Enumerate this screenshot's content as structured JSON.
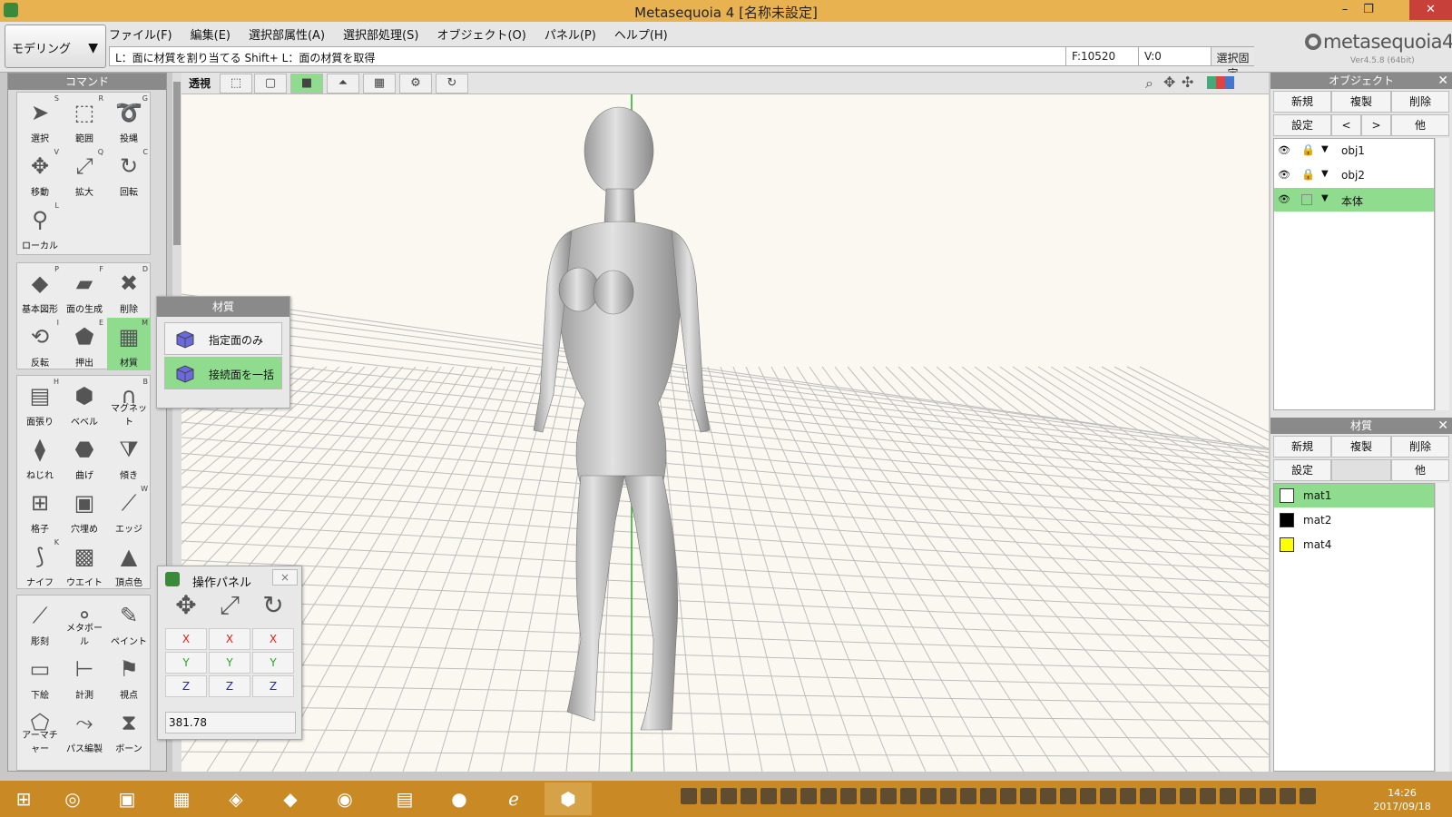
{
  "window": {
    "title": "Metasequoia 4 [名称未設定]"
  },
  "mode": {
    "label": "モデリング"
  },
  "menu": [
    "ファイル(F)",
    "編集(E)",
    "選択部属性(A)",
    "選択部処理(S)",
    "オブジェクト(O)",
    "パネル(P)",
    "ヘルプ(H)"
  ],
  "status": {
    "message": "L：面に材質を割り当てる  Shift+ L：面の材質を取得",
    "faces": "F:10520",
    "vertices": "V:0",
    "lock_label": "選択固定"
  },
  "logo": {
    "text": "metasequoia4",
    "version": "Ver4.5.8 (64bit)"
  },
  "command_panel": {
    "header": "コマンド",
    "group1": [
      {
        "label": "選択",
        "key": "S",
        "icon": "cursor-icon"
      },
      {
        "label": "範囲",
        "key": "R",
        "icon": "range-select-icon"
      },
      {
        "label": "投縄",
        "key": "G",
        "icon": "lasso-icon"
      },
      {
        "label": "移動",
        "key": "V",
        "icon": "move-icon"
      },
      {
        "label": "拡大",
        "key": "Q",
        "icon": "scale-icon"
      },
      {
        "label": "回転",
        "key": "C",
        "icon": "rotate-icon"
      },
      {
        "label": "ローカル",
        "key": "L",
        "icon": "local-icon"
      }
    ],
    "group2": [
      {
        "label": "基本図形",
        "key": "P",
        "icon": "primitive-icon"
      },
      {
        "label": "面の生成",
        "key": "F",
        "icon": "create-face-icon"
      },
      {
        "label": "削除",
        "key": "D",
        "icon": "delete-icon"
      },
      {
        "label": "反転",
        "key": "I",
        "icon": "flip-icon"
      },
      {
        "label": "押出",
        "key": "E",
        "icon": "extrude-icon"
      },
      {
        "label": "材質",
        "key": "M",
        "icon": "material-icon"
      }
    ],
    "group3": [
      {
        "label": "面張り",
        "key": "H",
        "icon": "face-fill-icon"
      },
      {
        "label": "ベベル",
        "key": "",
        "icon": "bevel-icon"
      },
      {
        "label": "マグネット",
        "key": "B",
        "icon": "magnet-icon"
      },
      {
        "label": "ねじれ",
        "key": "",
        "icon": "twist-icon"
      },
      {
        "label": "曲げ",
        "key": "",
        "icon": "bend-icon"
      },
      {
        "label": "傾き",
        "key": "",
        "icon": "tilt-icon"
      },
      {
        "label": "格子",
        "key": "",
        "icon": "lattice-icon"
      },
      {
        "label": "穴埋め",
        "key": "",
        "icon": "fill-hole-icon"
      },
      {
        "label": "エッジ",
        "key": "W",
        "icon": "edge-icon"
      },
      {
        "label": "ナイフ",
        "key": "K",
        "icon": "knife-icon"
      },
      {
        "label": "ウエイト",
        "key": "",
        "icon": "weight-icon"
      },
      {
        "label": "頂点色",
        "key": "",
        "icon": "vertex-color-icon"
      }
    ],
    "group4": [
      {
        "label": "彫刻",
        "key": "",
        "icon": "sculpt-icon"
      },
      {
        "label": "メタボール",
        "key": "",
        "icon": "metaball-icon"
      },
      {
        "label": "ペイント",
        "key": "",
        "icon": "paint-icon"
      },
      {
        "label": "下絵",
        "key": "",
        "icon": "underlay-icon"
      },
      {
        "label": "計測",
        "key": "",
        "icon": "measure-icon"
      },
      {
        "label": "視点",
        "key": "",
        "icon": "camera-icon"
      },
      {
        "label": "アーマチャー",
        "key": "",
        "icon": "armature-icon"
      },
      {
        "label": "パス編製",
        "key": "",
        "icon": "path-icon"
      },
      {
        "label": "ボーン",
        "key": "",
        "icon": "bone-icon"
      }
    ]
  },
  "view_toolbar": {
    "perspective": "透視"
  },
  "material_popup": {
    "title": "材質",
    "option1": "指定面のみ",
    "option2": "接続面を一括"
  },
  "op_panel": {
    "title": "操作パネル",
    "close": "×",
    "x": "X",
    "y": "Y",
    "z": "Z",
    "value": "381.78"
  },
  "object_panel": {
    "title": "オブジェクト",
    "buttons": {
      "new": "新規",
      "dup": "複製",
      "del": "削除",
      "settings": "設定",
      "prev": "<",
      "next": ">",
      "other": "他"
    },
    "items": [
      {
        "name": "obj1",
        "locked": true,
        "selected": false
      },
      {
        "name": "obj2",
        "locked": true,
        "selected": false
      },
      {
        "name": "本体",
        "locked": false,
        "selected": true
      }
    ]
  },
  "material_panel": {
    "title": "材質",
    "buttons": {
      "new": "新規",
      "dup": "複製",
      "del": "削除",
      "settings": "設定",
      "other": "他"
    },
    "items": [
      {
        "name": "mat1",
        "color": "#ffffff",
        "selected": true
      },
      {
        "name": "mat2",
        "color": "#000000",
        "selected": false
      },
      {
        "name": "mat4",
        "color": "#ffff00",
        "selected": false
      }
    ]
  },
  "clock": {
    "time": "14:26",
    "date": "2017/09/18"
  },
  "colors": {
    "accent_green": "#8fdc8f",
    "titlebar": "#e9b251",
    "taskbar": "#c98a25"
  }
}
